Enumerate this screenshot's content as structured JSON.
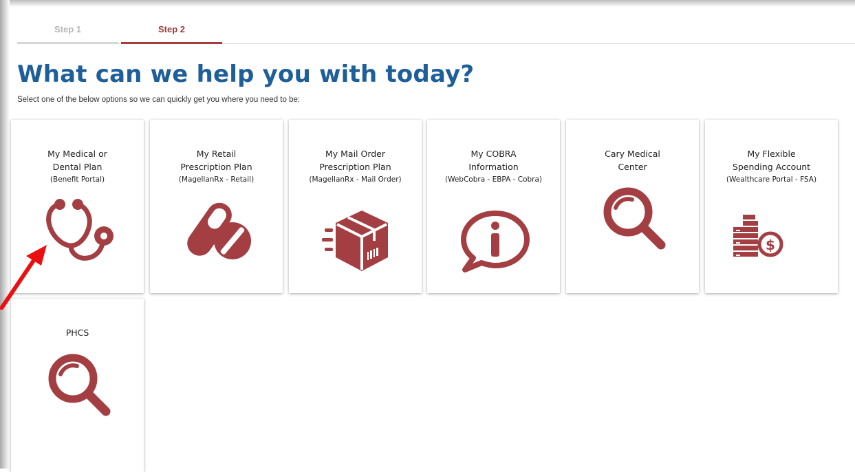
{
  "steps": [
    {
      "label": "Step 1",
      "active": false
    },
    {
      "label": "Step 2",
      "active": true
    }
  ],
  "heading": "What can we help you with today?",
  "subheading": "Select one of the below options so we can quickly get you where you need to be:",
  "colors": {
    "accent": "#a33f42",
    "heading": "#1f5f99",
    "step_active": "#9a3c3c"
  },
  "cards": [
    {
      "line1": "My Medical or",
      "line2": "Dental Plan",
      "sub": "(Benefit Portal)",
      "icon": "stethoscope-icon"
    },
    {
      "line1": "My Retail",
      "line2": "Prescription Plan",
      "sub": "(MagellanRx - Retail)",
      "icon": "pills-icon"
    },
    {
      "line1": "My Mail Order",
      "line2": "Prescription Plan",
      "sub": "(MagellanRx - Mail Order)",
      "icon": "package-icon"
    },
    {
      "line1": "My COBRA",
      "line2": "Information",
      "sub": "(WebCobra - EBPA - Cobra)",
      "icon": "info-icon"
    },
    {
      "line1": "Cary Medical",
      "line2": "Center",
      "sub": "",
      "icon": "magnifier-icon"
    },
    {
      "line1": "My Flexible",
      "line2": "Spending Account",
      "sub": "(Wealthcare Portal - FSA)",
      "icon": "money-icon"
    },
    {
      "line1": "PHCS",
      "line2": "",
      "sub": "",
      "icon": "magnifier-icon"
    }
  ]
}
